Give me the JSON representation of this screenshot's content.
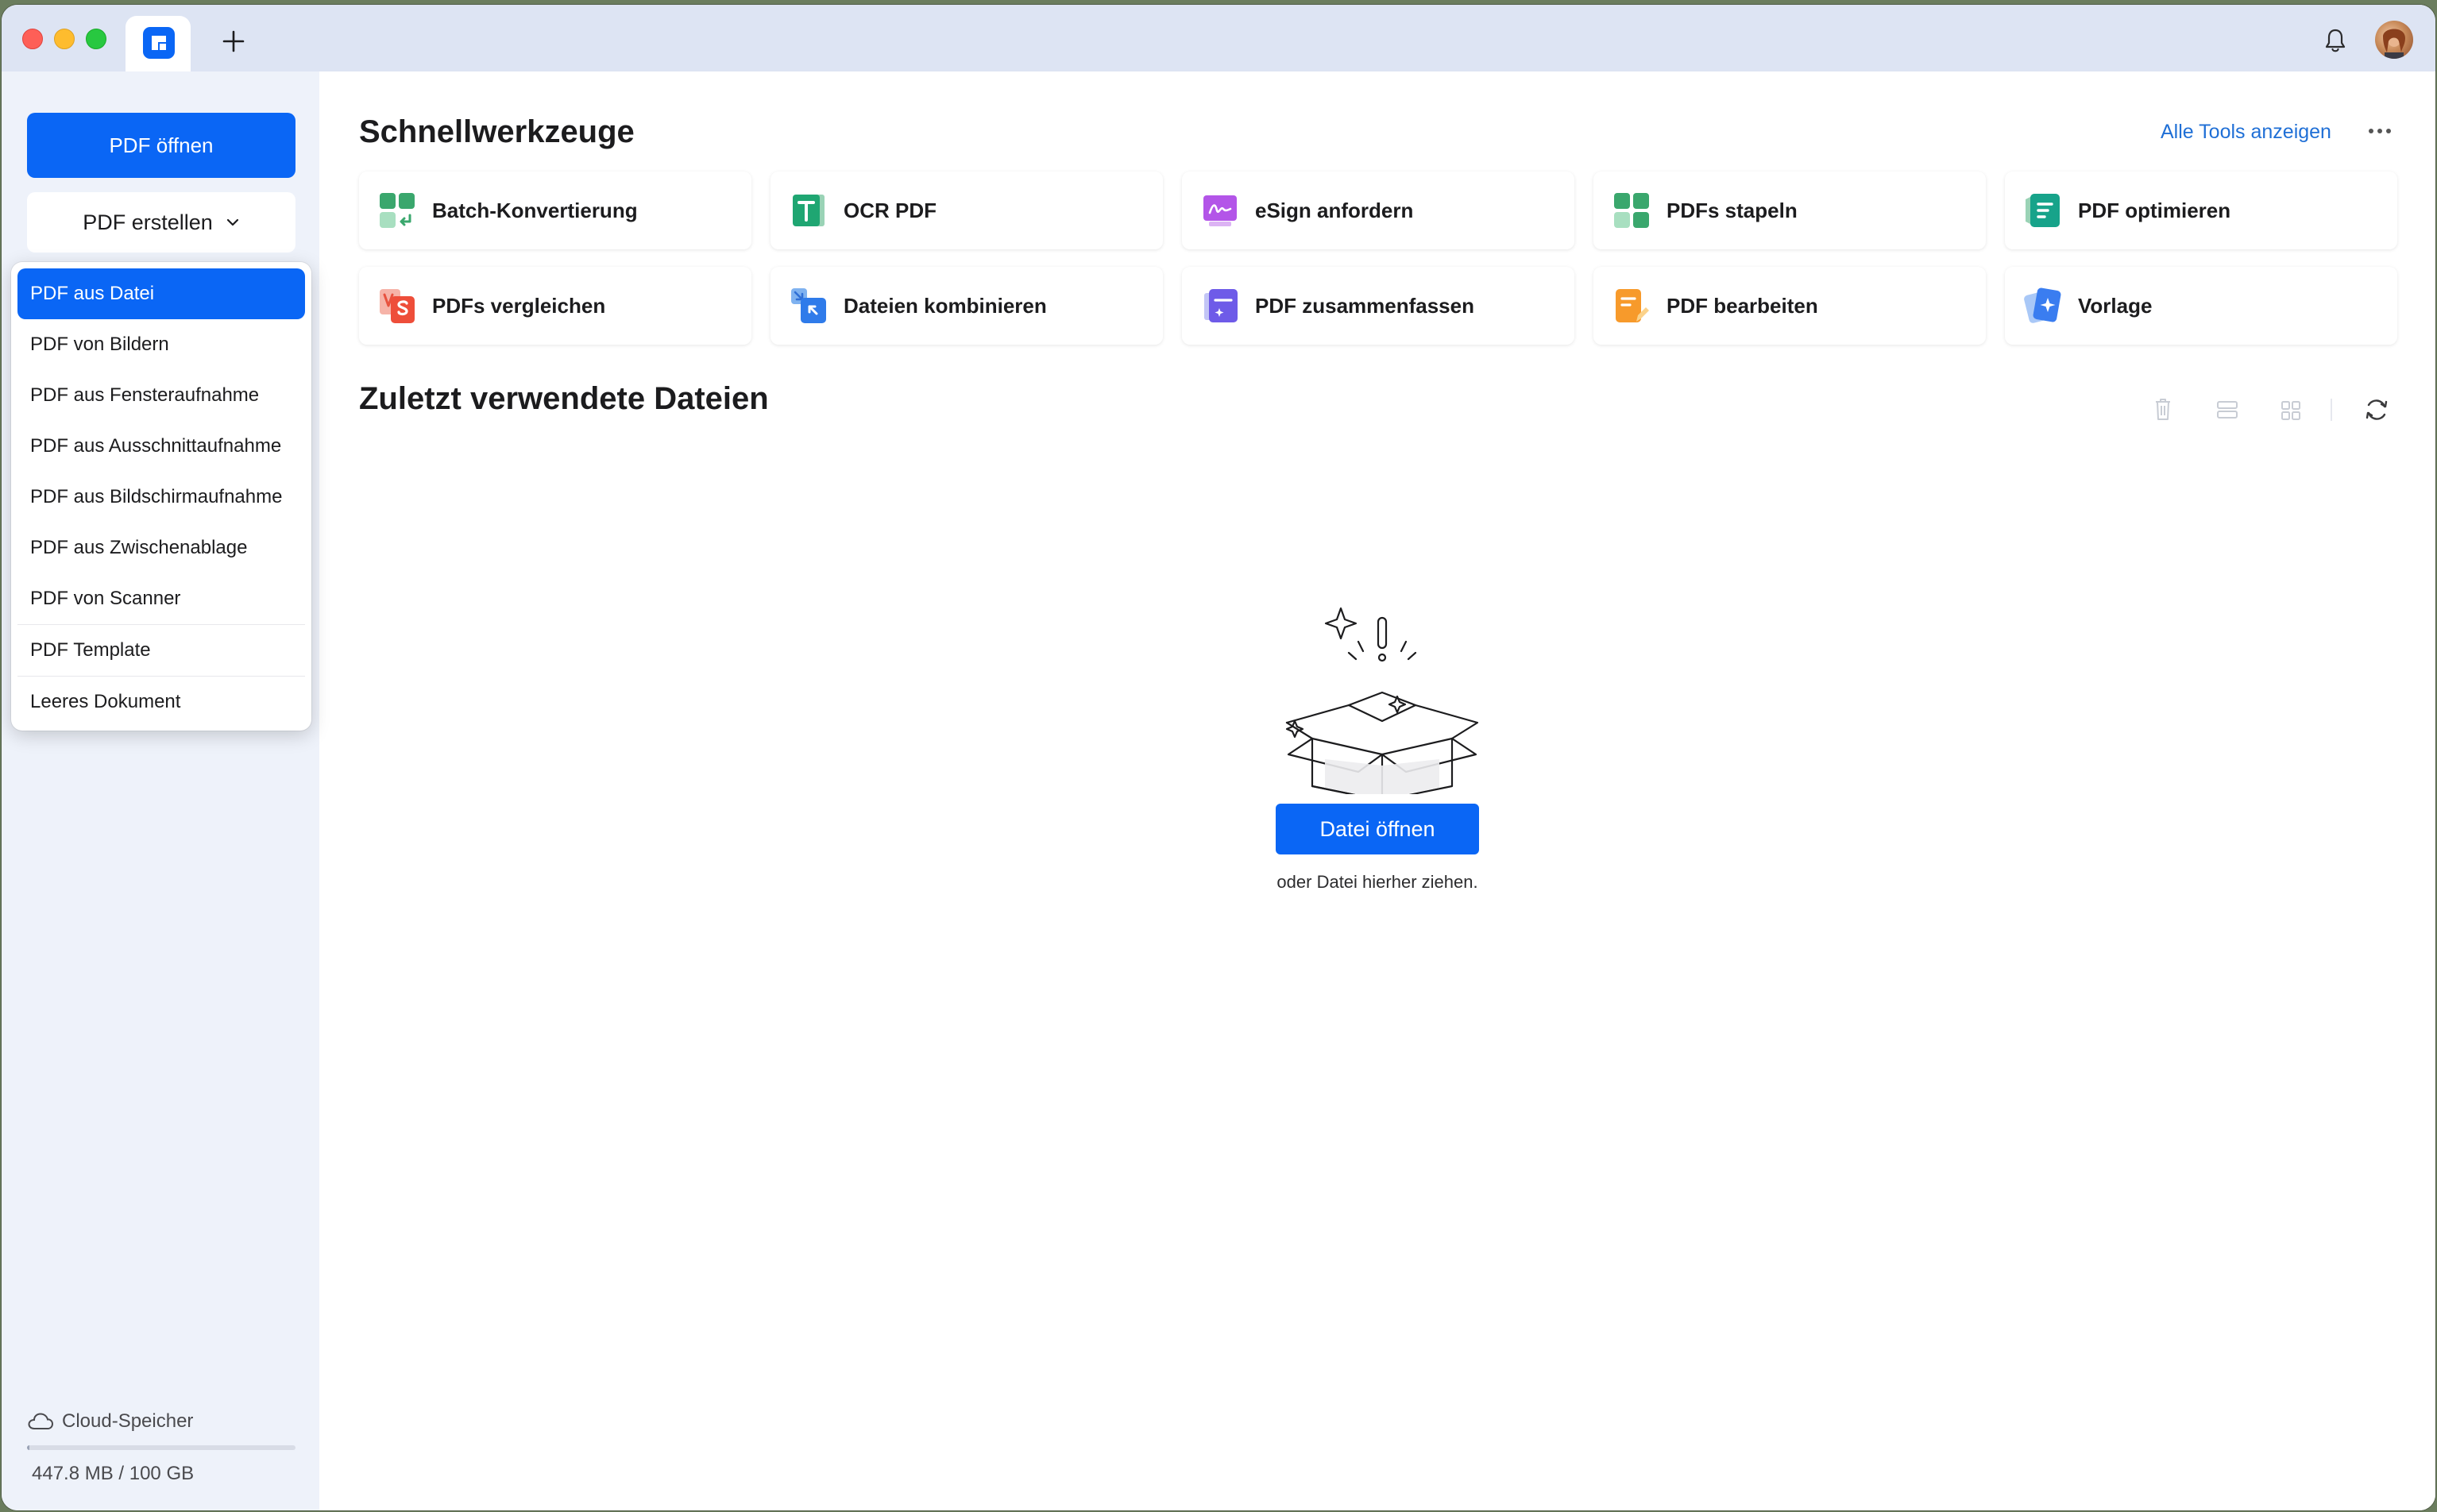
{
  "window": {
    "colors": {
      "accent": "#0a66f5",
      "link": "#1f6fd6",
      "sidebar_bg": "#eef2fa",
      "titlebar_bg": "#dde4f3"
    }
  },
  "titlebar": {
    "icons": [
      "close-icon",
      "minimize-icon",
      "zoom-icon",
      "app-logo-icon",
      "plus-icon",
      "bell-icon",
      "avatar"
    ]
  },
  "sidebar": {
    "open_pdf": "PDF öffnen",
    "create_pdf": "PDF erstellen",
    "cloud_label": "Cloud-Speicher",
    "storage_text": "447.8 MB / 100 GB",
    "storage_used_fraction": 0.0044
  },
  "dropdown": {
    "items": [
      "PDF aus Datei",
      "PDF von Bildern",
      "PDF aus Fensteraufnahme",
      "PDF aus Ausschnittaufnahme",
      "PDF aus Bildschirmaufnahme",
      "PDF aus Zwischenablage",
      "PDF von Scanner",
      "PDF Template",
      "Leeres Dokument"
    ],
    "selected_index": 0
  },
  "main": {
    "quick_tools_title": "Schnellwerkzeuge",
    "all_tools_link": "Alle Tools anzeigen",
    "tools": [
      {
        "label": "Batch-Konvertierung",
        "icon": "batch-convert-icon"
      },
      {
        "label": "OCR PDF",
        "icon": "ocr-icon"
      },
      {
        "label": "eSign anfordern",
        "icon": "esign-icon"
      },
      {
        "label": "PDFs stapeln",
        "icon": "batch-pdfs-icon"
      },
      {
        "label": "PDF optimieren",
        "icon": "compress-icon"
      },
      {
        "label": "PDFs vergleichen",
        "icon": "compare-icon"
      },
      {
        "label": "Dateien kombinieren",
        "icon": "combine-icon"
      },
      {
        "label": "PDF zusammenfassen",
        "icon": "summarize-icon"
      },
      {
        "label": "PDF bearbeiten",
        "icon": "edit-icon"
      },
      {
        "label": "Vorlage",
        "icon": "template-icon"
      }
    ],
    "recent_title": "Zuletzt verwendete Dateien",
    "open_file_button": "Datei öffnen",
    "drop_hint": "oder Datei hierher ziehen."
  }
}
